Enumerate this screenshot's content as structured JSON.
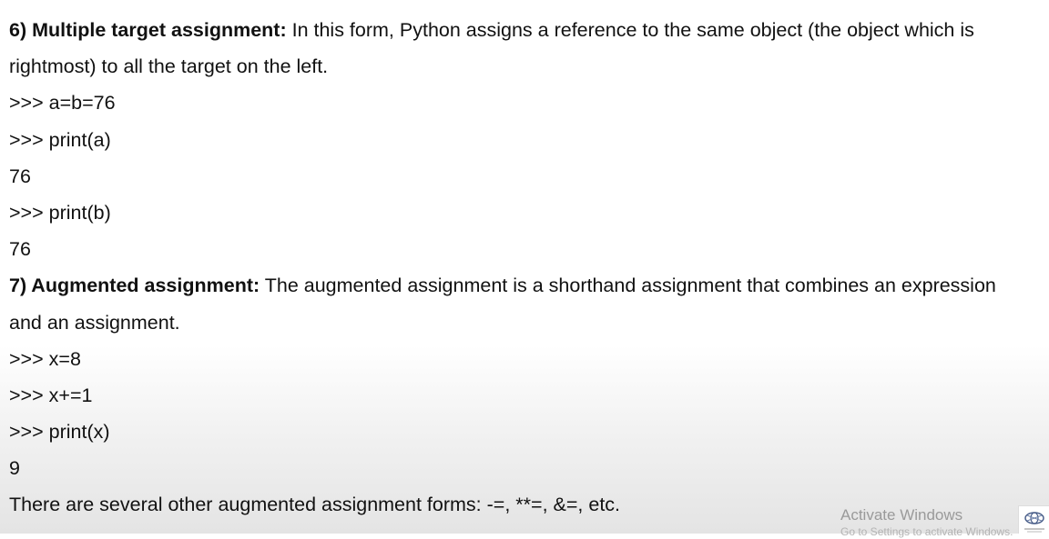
{
  "document": {
    "section6": {
      "heading": "6) Multiple target assignment:",
      "text_a": " In this form, Python assigns a reference to the same object (the object which is",
      "text_b": "rightmost) to all the target on the left.",
      "code": [
        ">>> a=b=76",
        ">>> print(a)",
        "76",
        ">>> print(b)",
        "76"
      ]
    },
    "section7": {
      "heading": "7) Augmented assignment:",
      "text_a": " The augmented assignment is a shorthand assignment that combines an expression",
      "text_b": "and an assignment.",
      "code": [
        ">>> x=8",
        ">>> x+=1",
        ">>> print(x)",
        "9"
      ],
      "footer_text": "There are several other augmented assignment forms: -=, **=, &=, etc."
    }
  },
  "overlay": {
    "watermark_title": "Activate Windows",
    "watermark_subtitle": "Go to Settings to activate Windows."
  }
}
